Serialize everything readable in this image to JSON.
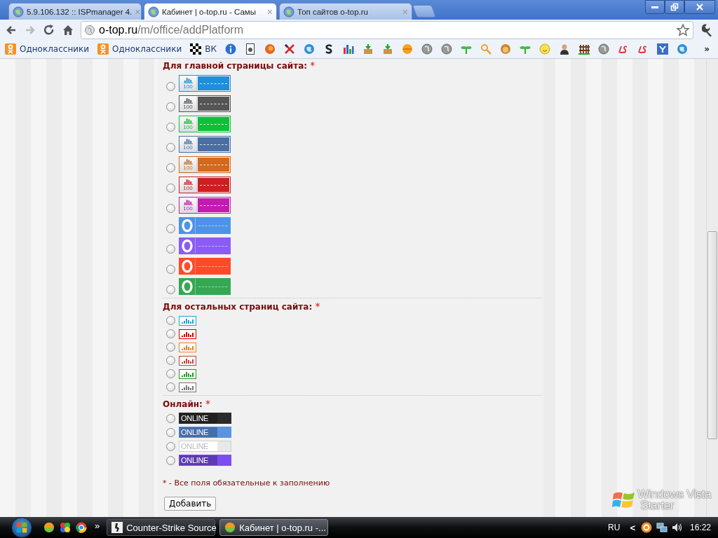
{
  "browser": {
    "tabs": [
      {
        "title": "5.9.106.132 :: ISPmanager 4.",
        "close": "×",
        "selected": false
      },
      {
        "title": "Кабинет | o-top.ru - Самы",
        "close": "×",
        "selected": true
      },
      {
        "title": "Топ сайтов o-top.ru",
        "close": "×",
        "selected": false
      }
    ],
    "address": {
      "host": "o-top.ru",
      "path": "/m/office/addPlatform"
    },
    "bookmarks": [
      {
        "label": "Одноклассники"
      },
      {
        "label": "Одноклассники"
      },
      {
        "label": "ВК"
      }
    ],
    "bookmarks_more": "»"
  },
  "form": {
    "sections": [
      {
        "title": "Для главной страницы сайта:",
        "required_mark": "*",
        "kind": "large",
        "options": [
          {
            "kind": "bars",
            "caption": "100",
            "color": "#1e8fd8",
            "selected": false
          },
          {
            "kind": "bars",
            "caption": "100",
            "color": "#555555",
            "selected": false
          },
          {
            "kind": "bars",
            "caption": "100",
            "color": "#0fbf3a",
            "selected": false
          },
          {
            "kind": "bars",
            "caption": "100",
            "color": "#4a6fa5",
            "selected": false
          },
          {
            "kind": "bars",
            "caption": "100",
            "color": "#d2691e",
            "selected": false
          },
          {
            "kind": "bars",
            "caption": "100",
            "color": "#cc1f1f",
            "selected": false
          },
          {
            "kind": "bars",
            "caption": "100",
            "color": "#c21bb0",
            "selected": false
          },
          {
            "kind": "ring",
            "color": "#4d94e8",
            "selected": false
          },
          {
            "kind": "ring",
            "color": "#8a5cf5",
            "selected": false
          },
          {
            "kind": "ring",
            "color": "#ff4a2a",
            "selected": false
          },
          {
            "kind": "ring",
            "color": "#34a853",
            "selected": false
          }
        ]
      },
      {
        "title": "Для остальных страниц сайта:",
        "required_mark": "*",
        "kind": "small",
        "options": [
          {
            "kind": "mini",
            "color": "#1aa7d6",
            "selected": false
          },
          {
            "kind": "mini",
            "color": "#d40000",
            "selected": false
          },
          {
            "kind": "mini",
            "color": "#f07f1a",
            "selected": false
          },
          {
            "kind": "mini",
            "color": "#b84545",
            "selected": false
          },
          {
            "kind": "mini",
            "color": "#1f9e1f",
            "selected": false
          },
          {
            "kind": "mini",
            "color": "#777777",
            "selected": false
          }
        ]
      },
      {
        "title": "Онлайн:",
        "required_mark": "*",
        "kind": "online",
        "options": [
          {
            "kind": "online",
            "label": "ONLINE",
            "color": "#2b2b2b",
            "selected": false
          },
          {
            "kind": "online",
            "label": "ONLINE",
            "color": "#5b93e0",
            "selected": false
          },
          {
            "kind": "online",
            "label": "ONLINE",
            "color": "#e8e8e8",
            "selected": false
          },
          {
            "kind": "online",
            "label": "ONLINE",
            "color": "#7c4ef2",
            "selected": false
          }
        ]
      }
    ],
    "note_mark": "*",
    "note": "- Все поля обязательные к заполнению",
    "submit": "Добавить"
  },
  "watermark": {
    "line1": "Windows Vista",
    "line2": "Starter"
  },
  "taskbar": {
    "more": "»",
    "tasks": [
      {
        "title": "Counter-Strike Source",
        "selected": false
      },
      {
        "title": "Кабинет | o-top.ru -...",
        "selected": true
      }
    ],
    "language": "RU",
    "tray_expand": "<",
    "clock": "16:22"
  }
}
